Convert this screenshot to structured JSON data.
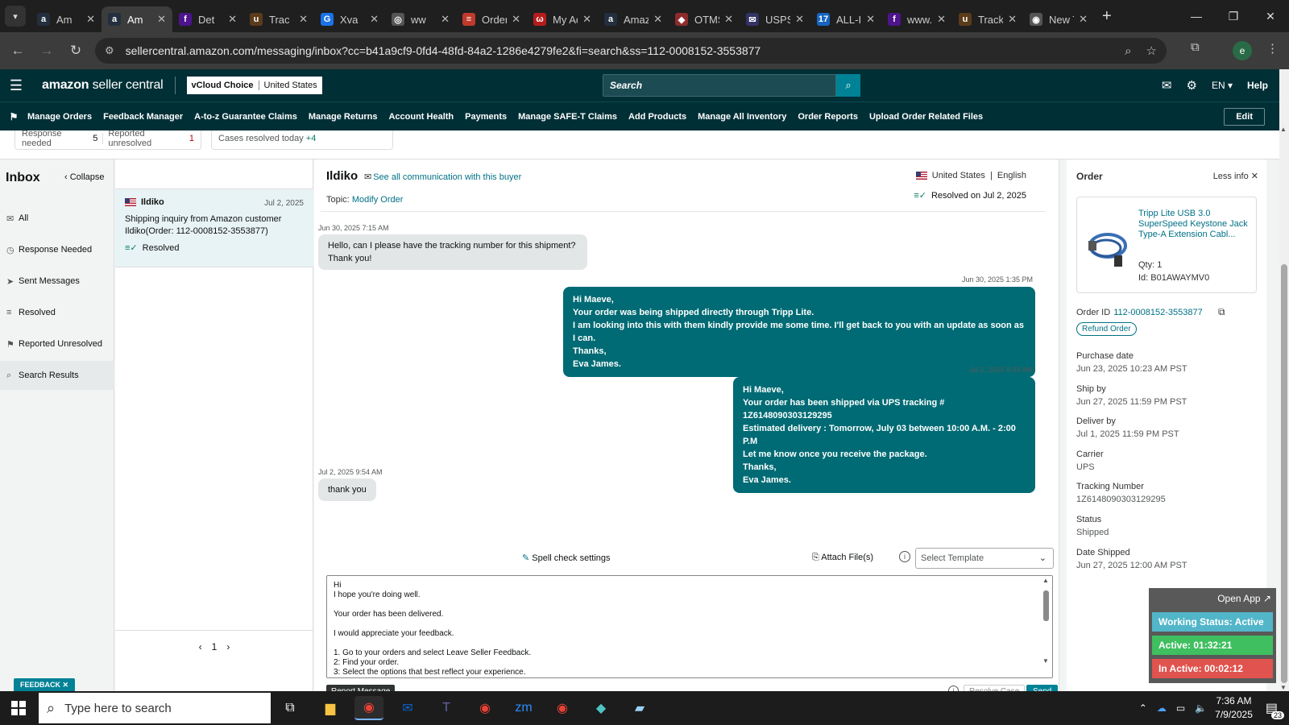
{
  "browser": {
    "tabs": [
      {
        "label": "Am",
        "icon": "amazon-icon",
        "color": "#232f3e",
        "glyph": "a",
        "active": false
      },
      {
        "label": "Am",
        "icon": "amazon-icon",
        "color": "#232f3e",
        "glyph": "a",
        "active": true
      },
      {
        "label": "Det",
        "icon": "fedex-icon",
        "color": "#4d148c",
        "glyph": "f",
        "active": false
      },
      {
        "label": "Trac",
        "icon": "ups-icon",
        "color": "#5a3b1a",
        "glyph": "u",
        "active": false
      },
      {
        "label": "Xva",
        "icon": "google-translate-icon",
        "color": "#1a73e8",
        "glyph": "G",
        "active": false
      },
      {
        "label": "ww",
        "icon": "globe-icon",
        "color": "#555555",
        "glyph": "◎",
        "active": false
      },
      {
        "label": "Orders",
        "icon": "orders-icon",
        "color": "#c0392b",
        "glyph": "≡",
        "active": false
      },
      {
        "label": "My Acc",
        "icon": "account-icon",
        "color": "#b71c1c",
        "glyph": "ω",
        "active": false
      },
      {
        "label": "Amazon",
        "icon": "amazon-icon",
        "color": "#232f3e",
        "glyph": "a",
        "active": false
      },
      {
        "label": "OTMS",
        "icon": "otms-icon",
        "color": "#8e2b2b",
        "glyph": "◆",
        "active": false
      },
      {
        "label": "USPS.cc",
        "icon": "usps-icon",
        "color": "#333366",
        "glyph": "✉",
        "active": false
      },
      {
        "label": "ALL-IN-",
        "icon": "17track-icon",
        "color": "#1565c0",
        "glyph": "17",
        "active": false
      },
      {
        "label": "www.fe",
        "icon": "fedex-icon",
        "color": "#4d148c",
        "glyph": "f",
        "active": false
      },
      {
        "label": "Tracking",
        "icon": "ups-icon",
        "color": "#5a3b1a",
        "glyph": "u",
        "active": false
      },
      {
        "label": "New Tal",
        "icon": "chrome-icon",
        "color": "#555555",
        "glyph": "◉",
        "active": false
      }
    ],
    "url": "sellercentral.amazon.com/messaging/inbox?cc=b41a9cf9-0fd4-48fd-84a2-1286e4279fe2&fi=search&ss=112-0008152-3553877",
    "profile_initial": "e"
  },
  "amazon": {
    "logo_main": "amazon",
    "logo_sub": " seller central",
    "store_brand": "vCloud Choice",
    "store_country": "United States",
    "search_placeholder": "Search",
    "lang": "EN",
    "help": "Help",
    "nav": [
      "Manage Orders",
      "Feedback Manager",
      "A-to-z Guarantee Claims",
      "Manage Returns",
      "Account Health",
      "Payments",
      "Manage SAFE-T Claims",
      "Add Products",
      "Manage All Inventory",
      "Order Reports",
      "Upload Order Related Files"
    ],
    "edit": "Edit"
  },
  "stats": {
    "response_needed_label": "Response needed",
    "response_needed_value": "5",
    "reported_unresolved_label": "Reported unresolved",
    "reported_unresolved_value": "1",
    "cases_resolved_label": "Cases resolved today",
    "cases_resolved_value": "+4"
  },
  "inbox": {
    "title": "Inbox",
    "collapse": "Collapse",
    "folders": [
      {
        "label": "All",
        "icon": "mail-icon",
        "glyph": "✉"
      },
      {
        "label": "Response Needed",
        "icon": "clock-icon",
        "glyph": "◷"
      },
      {
        "label": "Sent Messages",
        "icon": "send-icon",
        "glyph": "➤"
      },
      {
        "label": "Resolved",
        "icon": "resolved-icon",
        "glyph": "≡"
      },
      {
        "label": "Reported Unresolved",
        "icon": "report-icon",
        "glyph": "⚑"
      },
      {
        "label": "Search Results",
        "icon": "search-icon",
        "glyph": "⌕"
      }
    ],
    "selected_folder": "Search Results"
  },
  "conversation": {
    "name": "Ildiko",
    "date": "Jul 2, 2025",
    "snippet_line1": "Shipping inquiry from Amazon customer",
    "snippet_line2": "Ildiko(Order: 112-0008152-3553877)",
    "status": "Resolved",
    "page": "1"
  },
  "thread": {
    "buyer": "Ildiko",
    "see_all": "See all communication with this buyer",
    "topic_label": "Topic:",
    "topic": "Modify Order",
    "country": "United States",
    "language": "English",
    "resolved_on": "Resolved on Jul 2, 2025",
    "messages": [
      {
        "ts": "Jun 30, 2025 7:15 AM",
        "dir": "in",
        "lines": [
          "Hello, can I please have the tracking number for this shipment?",
          "Thank you!"
        ]
      },
      {
        "ts": "Jun 30, 2025 1:35 PM",
        "dir": "out",
        "lines": [
          "Hi Maeve,",
          "Your order was being shipped directly through Tripp Lite.",
          "I am looking into this with them kindly provide me some time. I'll get back to you with an update as soon as I can.",
          "Thanks,",
          "Eva James."
        ]
      },
      {
        "ts": "Jul 2, 2025 9:39 AM",
        "dir": "out",
        "lines": [
          "Hi Maeve,",
          "Your order has been shipped via UPS tracking # 1Z6148090303129295",
          "Estimated delivery : Tomorrow, July 03 between 10:00 A.M. - 2:00 P.M",
          "Let me know once you receive the package.",
          "Thanks,",
          "Eva James."
        ]
      },
      {
        "ts": "Jul 2, 2025 9:54 AM",
        "dir": "in",
        "lines": [
          "thank you"
        ]
      }
    ],
    "spell_check": "Spell check settings",
    "attach": "Attach File(s)",
    "template_placeholder": "Select Template",
    "composer_lines": [
      "Hi",
      "I hope you're doing well.",
      "",
      "Your order has been delivered.",
      "",
      "I would appreciate your feedback.",
      "",
      "1. Go to your orders and select Leave Seller Feedback.",
      "2: Find your order.",
      "3: Select the options that best reflect your experience."
    ],
    "report": "Report Message",
    "resolve": "Resolve Case",
    "send": "Send"
  },
  "order": {
    "heading": "Order",
    "less_info": "Less info",
    "product_title": "Tripp Lite USB 3.0 SuperSpeed Keystone Jack Type-A Extension Cabl...",
    "qty_label": "Qty:",
    "qty": "1",
    "id_label": "Id:",
    "asin": "B01AWAYMV0",
    "order_id_label": "Order ID",
    "order_id": "112-0008152-3553877",
    "refund": "Refund Order",
    "fields": [
      {
        "label": "Purchase date",
        "value": "Jun 23, 2025 10:23 AM PST"
      },
      {
        "label": "Ship by",
        "value": "Jun 27, 2025 11:59 PM PST"
      },
      {
        "label": "Deliver by",
        "value": "Jul 1, 2025 11:59 PM PST"
      },
      {
        "label": "Carrier",
        "value": "UPS"
      },
      {
        "label": "Tracking Number",
        "value": "1Z6148090303129295"
      },
      {
        "label": "Status",
        "value": "Shipped"
      },
      {
        "label": "Date Shipped",
        "value": "Jun 27, 2025 12:00 AM PST"
      }
    ]
  },
  "feedback": "FEEDBACK",
  "widget": {
    "open_app": "Open App",
    "working_status": "Working Status: Active",
    "active": "Active: 01:32:21",
    "inactive": "In Active: 00:02:12",
    "colors": {
      "working": "#52b6c9",
      "active": "#3fbf5f",
      "inactive": "#e0534e"
    }
  },
  "taskbar": {
    "search_placeholder": "Type here to search",
    "time": "7:36 AM",
    "date": "7/9/2025",
    "notifications": "23"
  }
}
